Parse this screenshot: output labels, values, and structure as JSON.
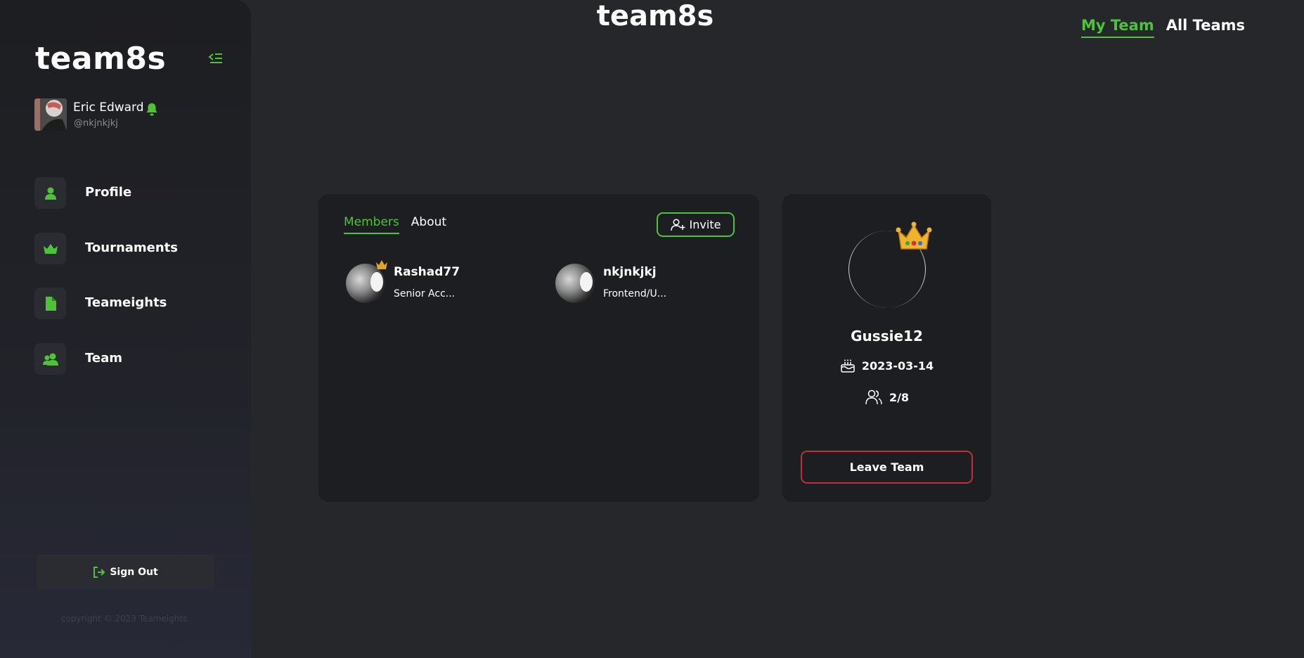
{
  "app": {
    "logo": "team8s",
    "page_title": "team8s",
    "accent_color": "#4dc437",
    "danger_color": "#c0303a"
  },
  "user": {
    "name": "Eric Edward",
    "handle": "@nkjnkjkj"
  },
  "sidebar": {
    "items": [
      {
        "label": "Profile",
        "icon": "user-icon"
      },
      {
        "label": "Tournaments",
        "icon": "crown-icon"
      },
      {
        "label": "Teameights",
        "icon": "document-icon"
      },
      {
        "label": "Team",
        "icon": "users-icon"
      }
    ],
    "sign_out_label": "Sign Out",
    "copyright": "copyright © 2023 Teameights."
  },
  "top_tabs": [
    {
      "label": "My Team",
      "active": true
    },
    {
      "label": "All Teams",
      "active": false
    }
  ],
  "members_card": {
    "tabs": [
      {
        "label": "Members",
        "active": true
      },
      {
        "label": "About",
        "active": false
      }
    ],
    "invite_label": "Invite",
    "members": [
      {
        "name": "Rashad77",
        "role": "Senior Acc...",
        "is_leader": true
      },
      {
        "name": "nkjnkjkj",
        "role": "Frontend/U...",
        "is_leader": false
      }
    ]
  },
  "team": {
    "name": "Gussie12",
    "created": "2023-03-14",
    "members_count": "2/8",
    "leave_label": "Leave Team"
  }
}
